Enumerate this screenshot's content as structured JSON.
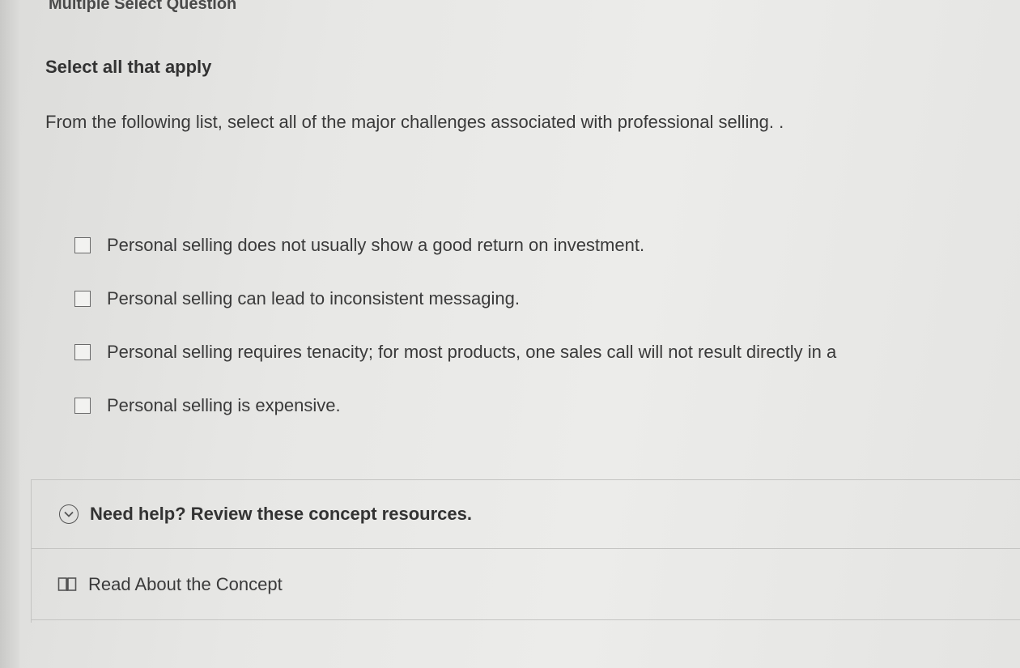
{
  "question": {
    "type_label": "Multiple Select Question",
    "instruction": "Select all that apply",
    "prompt": "From the following list, select all of the major challenges associated with professional selling.  ."
  },
  "options": [
    {
      "label": "Personal selling does not usually show a good return on investment.",
      "checked": false
    },
    {
      "label": "Personal selling can lead to inconsistent messaging.",
      "checked": false
    },
    {
      "label": "Personal selling requires tenacity; for most products, one sales call will not result directly in a",
      "checked": false
    },
    {
      "label": "Personal selling is expensive.",
      "checked": false
    }
  ],
  "help": {
    "toggle_label": "Need help? Review these concept resources.",
    "toggle_icon": "chevron-circle-icon",
    "resource_label": "Read About the Concept",
    "resource_icon": "book-icon"
  }
}
